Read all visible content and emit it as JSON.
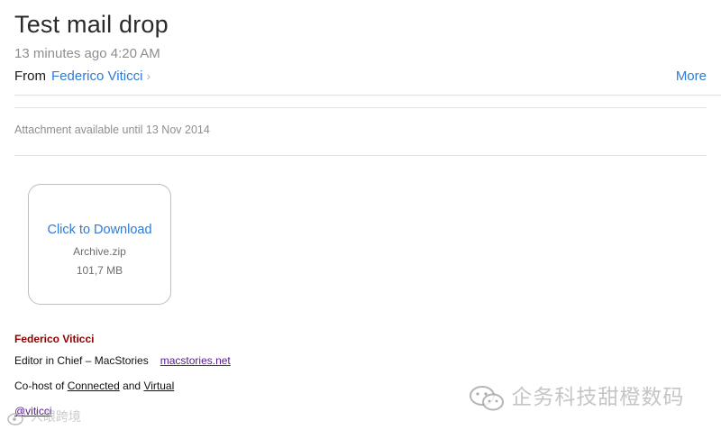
{
  "message": {
    "subject": "Test mail drop",
    "timestamp": "13 minutes ago 4:20 AM",
    "from_label": "From",
    "sender": "Federico Viticci",
    "more_label": "More"
  },
  "attachment": {
    "availability_note": "Attachment available until 13 Nov 2014",
    "download_label": "Click to Download",
    "file_name": "Archive.zip",
    "file_size": "101,7 MB"
  },
  "signature": {
    "name": "Federico Viticci",
    "role": "Editor in Chief – MacStories",
    "site_link": "macstories.net",
    "cohost_prefix": "Co-host of ",
    "show1": "Connected",
    "and_text": " and ",
    "show2": "Virtual",
    "handle": "@viticci"
  },
  "watermarks": {
    "left_text": "人眼跨境",
    "right_text": "企务科技甜橙数码"
  },
  "colors": {
    "link_blue": "#2f7bd6",
    "signature_name": "#8b0000",
    "visited_link": "#551a8b"
  }
}
